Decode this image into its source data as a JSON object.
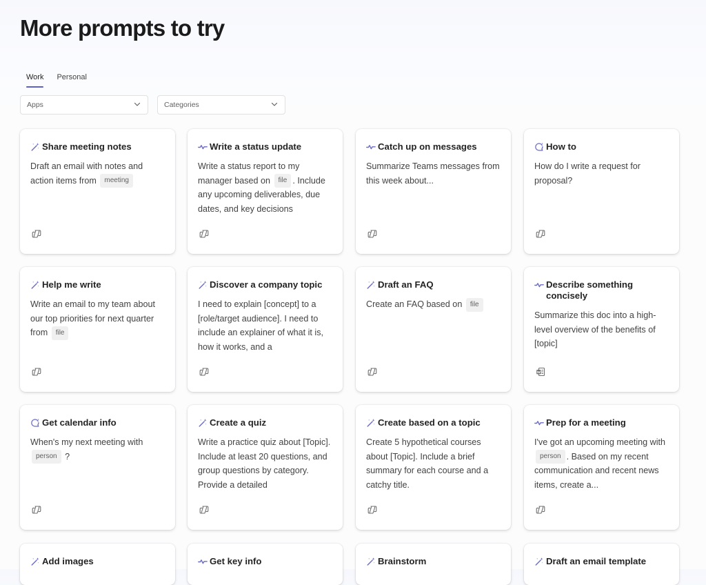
{
  "page": {
    "title": "More prompts to try"
  },
  "tabs": [
    {
      "label": "Work",
      "active": true
    },
    {
      "label": "Personal",
      "active": false
    }
  ],
  "filters": {
    "apps": {
      "placeholder": "Apps"
    },
    "categories": {
      "placeholder": "Categories"
    }
  },
  "colors": {
    "accent": "#5b5fc7",
    "icon": "#6b6bc8"
  },
  "cards": [
    {
      "title": "Share meeting notes",
      "icon": "wand-icon",
      "app_icon": "copilot-icon",
      "body": [
        {
          "t": "Draft an email with notes and action items from "
        },
        {
          "chip": "meeting"
        }
      ]
    },
    {
      "title": "Write a status update",
      "icon": "pulse-icon",
      "app_icon": "copilot-icon",
      "body": [
        {
          "t": "Write a status report to my manager based on "
        },
        {
          "chip": "file"
        },
        {
          "t": ". Include any upcoming deliverables, due dates, and key decisions"
        }
      ]
    },
    {
      "title": "Catch up on messages",
      "icon": "pulse-icon",
      "app_icon": "copilot-icon",
      "body": [
        {
          "t": "Summarize Teams messages from this week about..."
        }
      ]
    },
    {
      "title": "How to",
      "icon": "chat-bubble-icon",
      "app_icon": "copilot-icon",
      "body": [
        {
          "t": "How do I write a request for proposal?"
        }
      ]
    },
    {
      "title": "Help me write",
      "icon": "wand-icon",
      "app_icon": "copilot-icon",
      "body": [
        {
          "t": "Write an email to my team about our top priorities for next quarter from "
        },
        {
          "chip": "file"
        }
      ]
    },
    {
      "title": "Discover a company topic",
      "icon": "wand-icon",
      "app_icon": "copilot-icon",
      "body": [
        {
          "t": "I need to explain [concept] to a [role/target audience]. I need to include an explainer of what it is, how it works, and a"
        }
      ]
    },
    {
      "title": "Draft an FAQ",
      "icon": "wand-icon",
      "app_icon": "copilot-icon",
      "body": [
        {
          "t": "Create an FAQ based on "
        },
        {
          "chip": "file"
        }
      ]
    },
    {
      "title": "Describe something concisely",
      "icon": "pulse-icon",
      "app_icon": "word-doc-icon",
      "body": [
        {
          "t": "Summarize this doc into a high-level overview of the benefits of [topic]"
        }
      ]
    },
    {
      "title": "Get calendar info",
      "icon": "chat-bubble-icon",
      "app_icon": "copilot-icon",
      "body": [
        {
          "t": "When's my next meeting with "
        },
        {
          "chip": "person"
        },
        {
          "t": " ?"
        }
      ]
    },
    {
      "title": "Create a quiz",
      "icon": "wand-icon",
      "app_icon": "copilot-icon",
      "body": [
        {
          "t": "Write a practice quiz about [Topic]. Include at least 20 questions, and group questions by category. Provide a detailed"
        }
      ]
    },
    {
      "title": "Create based on a topic",
      "icon": "wand-icon",
      "app_icon": "copilot-icon",
      "body": [
        {
          "t": "Create 5 hypothetical courses about [Topic]. Include a brief summary for each course and a catchy title."
        }
      ]
    },
    {
      "title": "Prep for a meeting",
      "icon": "pulse-icon",
      "app_icon": "copilot-icon",
      "body": [
        {
          "t": "I've got an upcoming meeting with "
        },
        {
          "chip": "person"
        },
        {
          "t": ". Based on my recent communication and recent news items, create a..."
        }
      ]
    },
    {
      "title": "Add images",
      "icon": "wand-icon",
      "body": []
    },
    {
      "title": "Get key info",
      "icon": "pulse-icon",
      "body": []
    },
    {
      "title": "Brainstorm",
      "icon": "wand-icon",
      "body": []
    },
    {
      "title": "Draft an email template",
      "icon": "wand-icon",
      "body": []
    }
  ]
}
